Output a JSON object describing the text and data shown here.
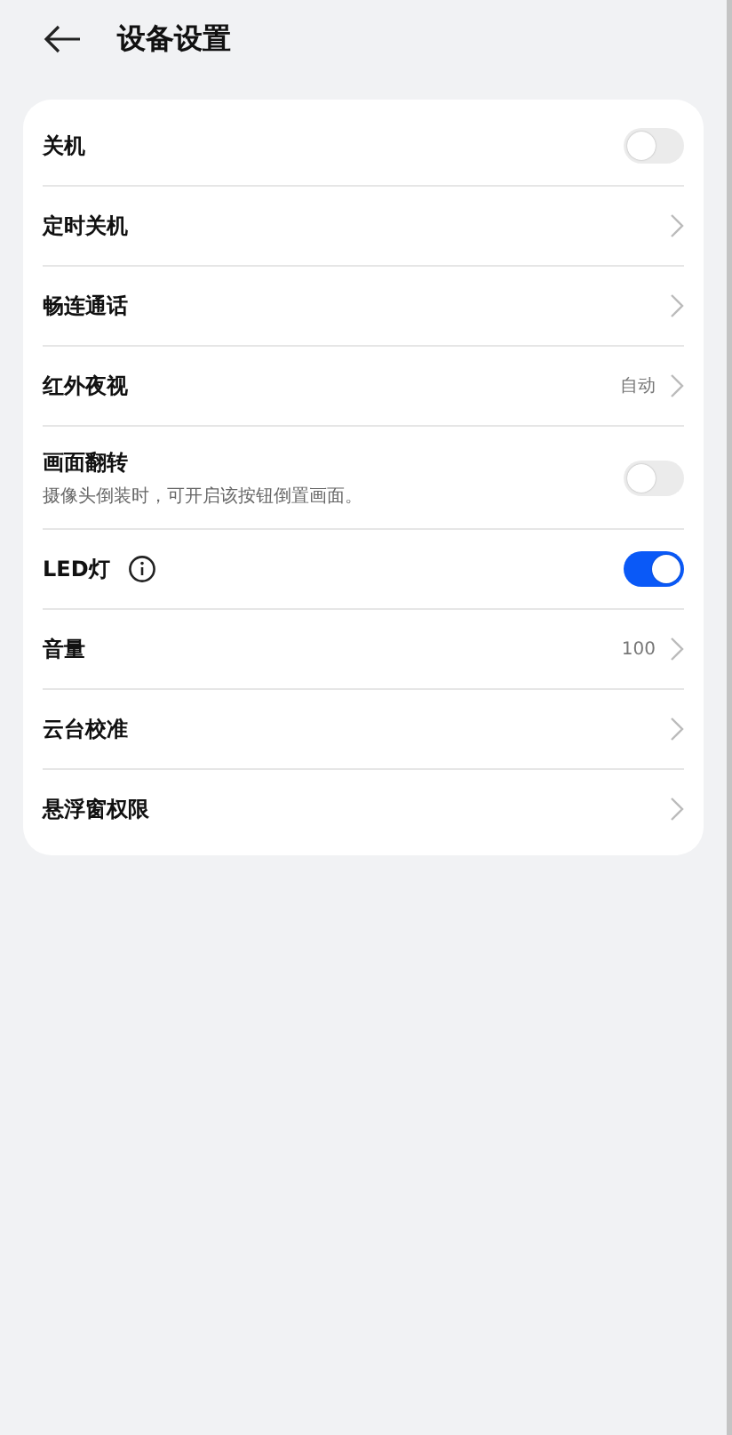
{
  "header": {
    "title": "设备设置"
  },
  "settings": [
    {
      "kind": "toggle",
      "label": "关机",
      "on": false
    },
    {
      "kind": "link",
      "label": "定时关机"
    },
    {
      "kind": "link",
      "label": "畅连通话"
    },
    {
      "kind": "link",
      "label": "红外夜视",
      "value": "自动"
    },
    {
      "kind": "toggle",
      "label": "画面翻转",
      "description": "摄像头倒装时，可开启该按钮倒置画面。",
      "on": false
    },
    {
      "kind": "toggle",
      "label": "LED灯",
      "info": true,
      "on": true
    },
    {
      "kind": "link",
      "label": "音量",
      "value": "100"
    },
    {
      "kind": "link",
      "label": "云台校准"
    },
    {
      "kind": "link",
      "label": "悬浮窗权限"
    }
  ]
}
